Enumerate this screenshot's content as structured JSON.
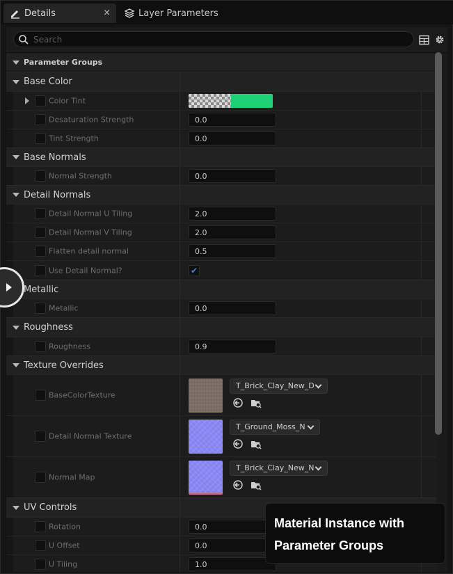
{
  "tabs": [
    {
      "label": "Details",
      "icon": "pencil-icon",
      "active": true
    },
    {
      "label": "Layer Parameters",
      "icon": "layers-icon",
      "active": false
    }
  ],
  "tab_close_glyph": "×",
  "search": {
    "placeholder": "Search",
    "value": ""
  },
  "toolbar": {
    "grid_icon": "table-view-icon",
    "settings_icon": "gear-icon"
  },
  "top_group": "Parameter Groups",
  "groups": {
    "base_color": {
      "label": "Base Color",
      "color_tint": {
        "name": "Color Tint",
        "color": "#1fd176"
      },
      "desaturation": {
        "name": "Desaturation Strength",
        "value": "0.0"
      },
      "tint_strength": {
        "name": "Tint Strength",
        "value": "0.0"
      }
    },
    "base_normals": {
      "label": "Base Normals",
      "normal_strength": {
        "name": "Normal Strength",
        "value": "0.0"
      }
    },
    "detail_normals": {
      "label": "Detail Normals",
      "u_tiling": {
        "name": "Detail Normal U Tiling",
        "value": "2.0"
      },
      "v_tiling": {
        "name": "Detail Normal V Tiling",
        "value": "2.0"
      },
      "flatten": {
        "name": "Flatten detail normal",
        "value": "0.5"
      },
      "use_detail": {
        "name": "Use Detail Normal?",
        "checked": true,
        "check_glyph": "✔"
      }
    },
    "metallic": {
      "label": "Metallic",
      "metallic": {
        "name": "Metallic",
        "value": "0.0"
      }
    },
    "roughness": {
      "label": "Roughness",
      "roughness": {
        "name": "Roughness",
        "value": "0.9"
      }
    },
    "texture_overrides": {
      "label": "Texture Overrides",
      "base_color_texture": {
        "name": "BaseColorTexture",
        "asset": "T_Brick_Clay_New_D"
      },
      "detail_normal_texture": {
        "name": "Detail Normal Texture",
        "asset": "T_Ground_Moss_N"
      },
      "normal_map": {
        "name": "Normal Map",
        "asset": "T_Brick_Clay_New_N"
      }
    },
    "uv_controls": {
      "label": "UV Controls",
      "rotation": {
        "name": "Rotation",
        "value": "0.0"
      },
      "u_offset": {
        "name": "U Offset",
        "value": "0.0"
      },
      "u_tiling": {
        "name": "U Tiling",
        "value": "1.0"
      }
    }
  },
  "caption": {
    "line1": "Material Instance with",
    "line2": "Parameter Groups"
  }
}
